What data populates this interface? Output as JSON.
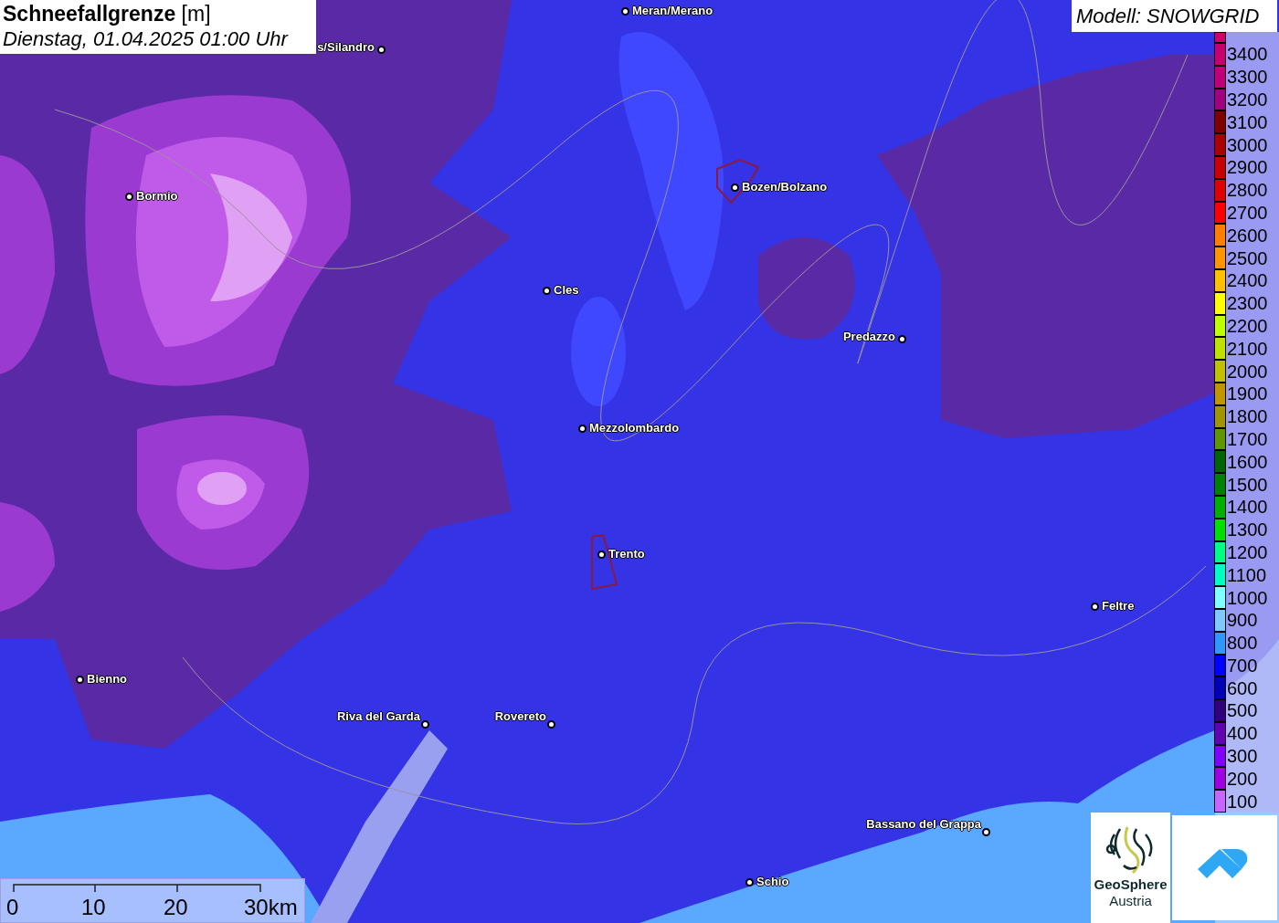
{
  "title": {
    "heading": "**Schneefallgrenze** [m]",
    "subtitle": "Dienstag, 01.04.2025 01:00 Uhr"
  },
  "model": "Modell: SNOWGRID",
  "cities": [
    "Meran/Merano",
    "s/Silandro",
    "Bormio",
    "Bozen/Bolzano",
    "Cles",
    "Predazzo",
    "Mezzolombardo",
    "Trento",
    "Feltre",
    "Bienno",
    "Riva del Garda",
    "Rovereto",
    "Bassano del Grappa",
    "Schio"
  ],
  "legend": [
    {
      "label": "3400",
      "color": "#c8006e"
    },
    {
      "label": "3300",
      "color": "#c00078"
    },
    {
      "label": "3200",
      "color": "#a00080"
    },
    {
      "label": "3100",
      "color": "#800000"
    },
    {
      "label": "3000",
      "color": "#aa0000"
    },
    {
      "label": "2900",
      "color": "#c80000"
    },
    {
      "label": "2800",
      "color": "#e00000"
    },
    {
      "label": "2700",
      "color": "#ff0000"
    },
    {
      "label": "2600",
      "color": "#ff8000"
    },
    {
      "label": "2500",
      "color": "#ff9600"
    },
    {
      "label": "2400",
      "color": "#ffc000"
    },
    {
      "label": "2300",
      "color": "#ffff00"
    },
    {
      "label": "2200",
      "color": "#c0ff00"
    },
    {
      "label": "2100",
      "color": "#c0e000"
    },
    {
      "label": "2000",
      "color": "#c0c000"
    },
    {
      "label": "1900",
      "color": "#c09600"
    },
    {
      "label": "1800",
      "color": "#a09600"
    },
    {
      "label": "1700",
      "color": "#609600"
    },
    {
      "label": "1600",
      "color": "#006400"
    },
    {
      "label": "1500",
      "color": "#008000"
    },
    {
      "label": "1400",
      "color": "#00b000"
    },
    {
      "label": "1300",
      "color": "#00e000"
    },
    {
      "label": "1200",
      "color": "#00ff80"
    },
    {
      "label": "1100",
      "color": "#00ffc0"
    },
    {
      "label": "1000",
      "color": "#80ffff"
    },
    {
      "label": "900",
      "color": "#80c8ff"
    },
    {
      "label": "800",
      "color": "#3296ff"
    },
    {
      "label": "700",
      "color": "#0000ff"
    },
    {
      "label": "600",
      "color": "#0000b4"
    },
    {
      "label": "500",
      "color": "#320078"
    },
    {
      "label": "400",
      "color": "#6400b4"
    },
    {
      "label": "300",
      "color": "#8200ff"
    },
    {
      "label": "200",
      "color": "#a000e0"
    },
    {
      "label": "100",
      "color": "#c864ff"
    }
  ],
  "scale_bar": [
    "0",
    "10",
    "20",
    "30km"
  ],
  "logo": {
    "name": "GeoSphere",
    "country": "Austria"
  }
}
